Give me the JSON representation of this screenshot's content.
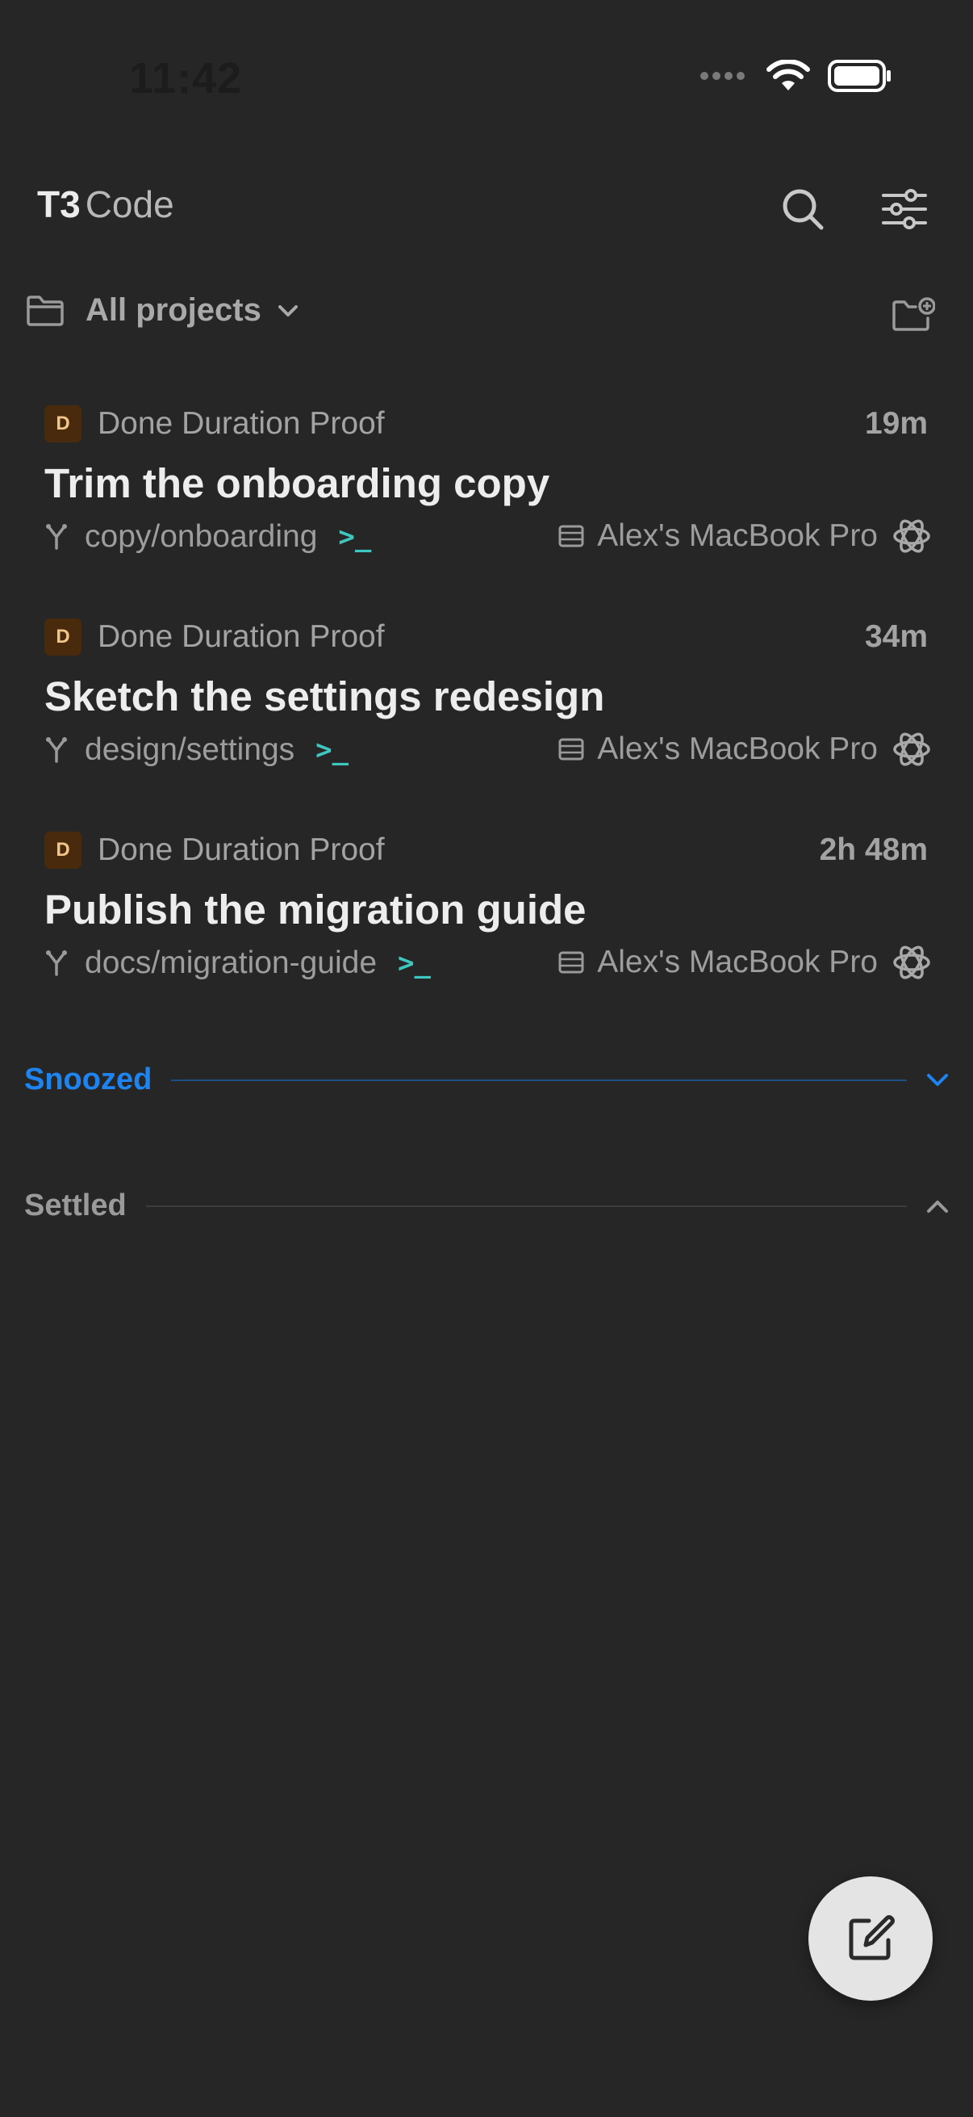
{
  "status_bar": {
    "time": "11:42"
  },
  "header": {
    "title_bold": "T3",
    "title_rest": "Code",
    "search_icon": "search-icon",
    "filter_icon": "sliders-icon"
  },
  "project_filter": {
    "label": "All projects",
    "folder_icon": "folder-icon",
    "chevron_icon": "chevron-down-icon",
    "new_project_icon": "folder-plus-icon"
  },
  "threads": [
    {
      "badge": "D",
      "project": "Done Duration Proof",
      "duration": "19m",
      "title": "Trim the onboarding copy",
      "branch": "copy/onboarding",
      "terminal": ">_",
      "host": "Alex's MacBook Pro"
    },
    {
      "badge": "D",
      "project": "Done Duration Proof",
      "duration": "34m",
      "title": "Sketch the settings redesign",
      "branch": "design/settings",
      "terminal": ">_",
      "host": "Alex's MacBook Pro"
    },
    {
      "badge": "D",
      "project": "Done Duration Proof",
      "duration": "2h 48m",
      "title": "Publish the migration guide",
      "branch": "docs/migration-guide",
      "terminal": ">_",
      "host": "Alex's MacBook Pro"
    }
  ],
  "sections": {
    "snoozed": {
      "label": "Snoozed",
      "color": "#1d84f0"
    },
    "settled": {
      "label": "Settled",
      "color": "#9a9a9a"
    }
  },
  "fab": {
    "icon": "compose-icon"
  },
  "colors": {
    "background": "#262626",
    "accent_blue": "#1d84f0",
    "terminal_teal": "#3ec6c0",
    "badge_bg": "#4a2a0c"
  }
}
